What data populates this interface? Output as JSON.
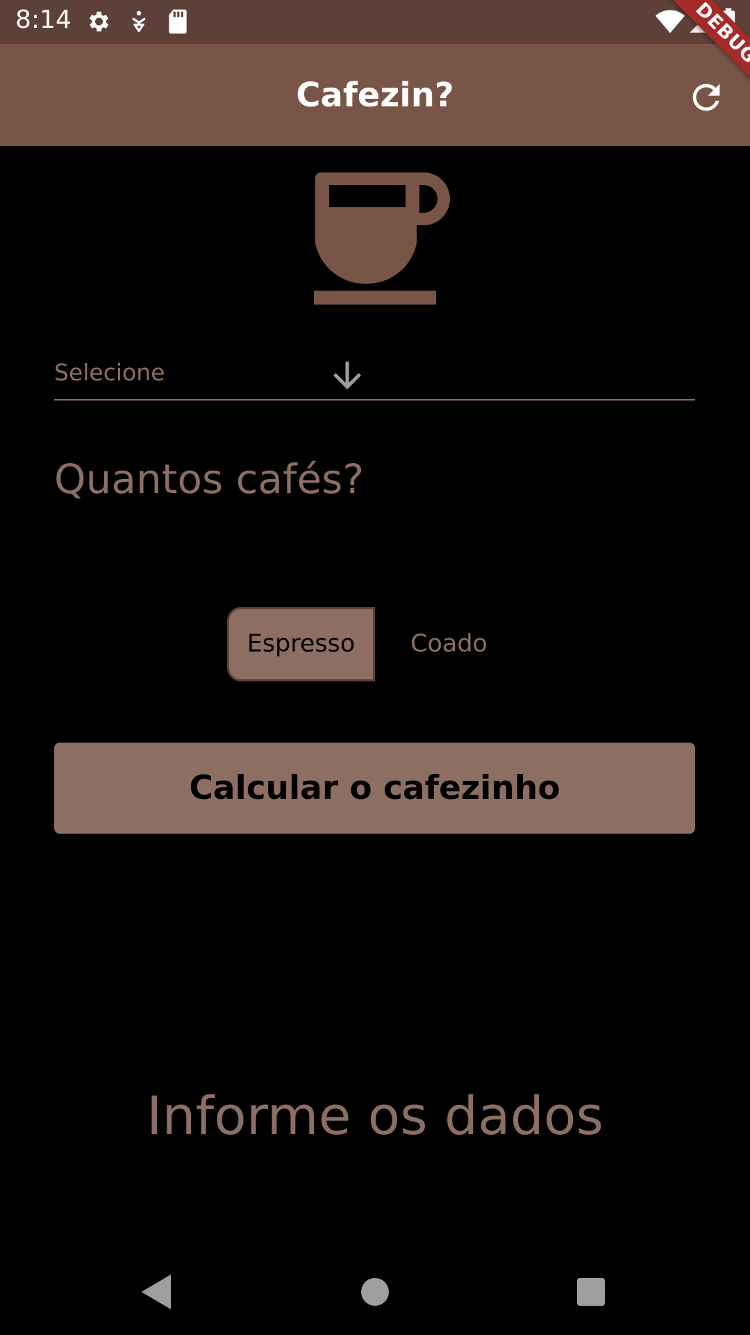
{
  "status_bar": {
    "time": "8:14",
    "icons": [
      "settings-icon",
      "accessibility-icon",
      "sd-card-icon",
      "wifi-icon",
      "signal-icon",
      "battery-icon"
    ]
  },
  "app_bar": {
    "title": "Cafezin?",
    "action_icon": "refresh-icon",
    "debug_label": "DEBUG"
  },
  "hero_icon": "coffee-cup-icon",
  "dropdown": {
    "placeholder": "Selecione",
    "icon": "arrow-down-icon"
  },
  "question": "Quantos cafés?",
  "toggle": {
    "options": [
      "Espresso",
      "Coado"
    ],
    "selected": "Espresso"
  },
  "calculate_button": "Calcular o cafezinho",
  "result": "Informe os dados",
  "nav_bar": {
    "buttons": [
      "back-icon",
      "home-icon",
      "recents-icon"
    ]
  },
  "colors": {
    "status_bar": "#5d4037",
    "app_bar": "#795548",
    "accent": "#8d6e63",
    "icon": "#795548",
    "background": "#000000",
    "debug_banner": "#a52a2a"
  }
}
